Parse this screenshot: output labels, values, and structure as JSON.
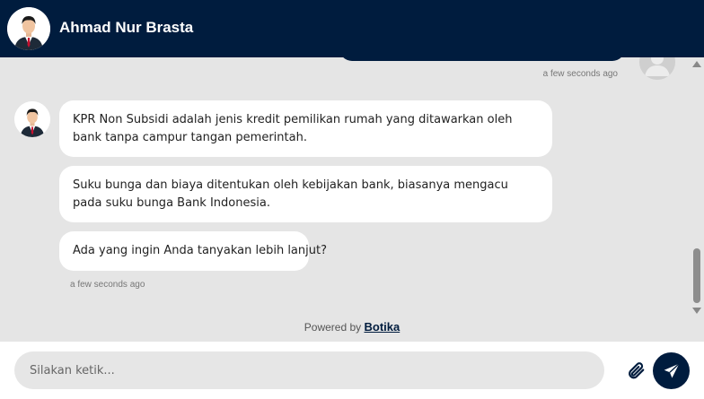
{
  "header": {
    "name": "Ahmad Nur Brasta",
    "avatar_icon": "businessman-avatar-icon"
  },
  "user_message": {
    "timestamp": "a few seconds ago",
    "avatar_icon": "user-placeholder-avatar-icon"
  },
  "bot_messages": [
    {
      "text": "KPR Non Subsidi adalah jenis kredit pemilikan rumah yang ditawarkan oleh bank tanpa campur tangan pemerintah."
    },
    {
      "text": "Suku bunga dan biaya ditentukan oleh kebijakan bank, biasanya mengacu pada suku bunga Bank Indonesia."
    },
    {
      "text": "Ada yang ingin Anda tanyakan lebih lanjut?"
    }
  ],
  "bot_timestamp": "a few seconds ago",
  "footer": {
    "powered_prefix": "Powered by",
    "powered_brand": "Botika"
  },
  "input": {
    "placeholder": "Silakan ketik..."
  },
  "colors": {
    "primary": "#001c3e",
    "chat_background": "#e5e5e5",
    "bubble": "#ffffff"
  }
}
